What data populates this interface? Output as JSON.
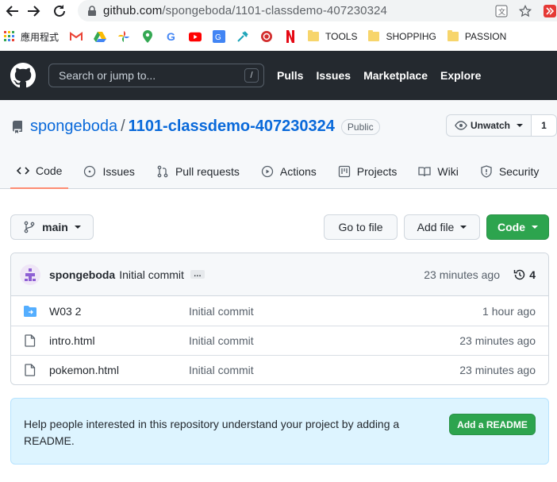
{
  "browser": {
    "url_host": "github.com",
    "url_path": "/spongeboda/1101-classdemo-407230324",
    "bookmarks": [
      {
        "label": "應用程式",
        "icon": "apps-grid-icon"
      },
      {
        "label": "",
        "icon": "gmail-icon"
      },
      {
        "label": "",
        "icon": "google-drive-icon"
      },
      {
        "label": "",
        "icon": "google-photos-icon"
      },
      {
        "label": "",
        "icon": "google-maps-icon"
      },
      {
        "label": "",
        "icon": "google-icon"
      },
      {
        "label": "",
        "icon": "youtube-icon"
      },
      {
        "label": "",
        "icon": "google-translate-icon"
      },
      {
        "label": "",
        "icon": "tool-icon"
      },
      {
        "label": "",
        "icon": "red-emblem-icon"
      },
      {
        "label": "",
        "icon": "netflix-icon"
      },
      {
        "label": "TOOLS",
        "icon": "folder-icon"
      },
      {
        "label": "SHOPPIHG",
        "icon": "folder-icon"
      },
      {
        "label": "PASSION",
        "icon": "folder-icon"
      }
    ]
  },
  "header": {
    "search_placeholder": "Search or jump to...",
    "search_key": "/",
    "nav": [
      "Pulls",
      "Issues",
      "Marketplace",
      "Explore"
    ]
  },
  "repo": {
    "owner": "spongeboda",
    "separator": "/",
    "name": "1101-classdemo-407230324",
    "visibility": "Public",
    "watch_label": "Unwatch",
    "watch_count": "1",
    "tabs": [
      {
        "label": "Code",
        "icon": "code-icon",
        "active": true
      },
      {
        "label": "Issues",
        "icon": "issue-icon"
      },
      {
        "label": "Pull requests",
        "icon": "pull-request-icon"
      },
      {
        "label": "Actions",
        "icon": "play-icon"
      },
      {
        "label": "Projects",
        "icon": "project-icon"
      },
      {
        "label": "Wiki",
        "icon": "book-icon"
      },
      {
        "label": "Security",
        "icon": "shield-icon"
      }
    ]
  },
  "toolbar": {
    "branch": "main",
    "go_to_file": "Go to file",
    "add_file": "Add file",
    "code": "Code"
  },
  "latest_commit": {
    "author": "spongeboda",
    "message": "Initial commit",
    "ellipsis": "…",
    "time": "23 minutes ago",
    "count": "4"
  },
  "files": [
    {
      "name": "W03 2",
      "type": "folder",
      "message": "Initial commit",
      "time": "1 hour ago"
    },
    {
      "name": "intro.html",
      "type": "file",
      "message": "Initial commit",
      "time": "23 minutes ago"
    },
    {
      "name": "pokemon.html",
      "type": "file",
      "message": "Initial commit",
      "time": "23 minutes ago"
    }
  ],
  "readme": {
    "text": "Help people interested in this repository understand your project by adding a README.",
    "button": "Add a README"
  },
  "colors": {
    "header_bg": "#24292f",
    "link": "#0969da",
    "green": "#2da44e",
    "active_tab": "#fd8c73",
    "readme_bg": "#ddf4ff"
  }
}
